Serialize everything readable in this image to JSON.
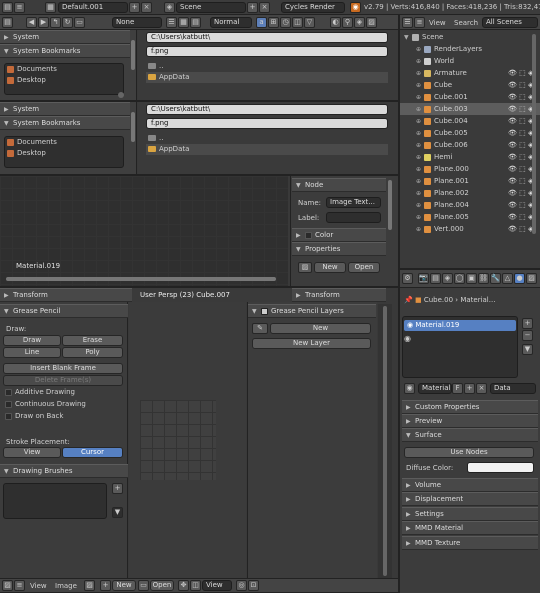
{
  "topbar": {
    "layout": "Default.001",
    "scene": "Scene",
    "engine": "Cycles Render",
    "stats": "v2.79 | Verts:416,840 | Faces:418,236 | Tris:832,472",
    "mode": "None",
    "blend_mode": "Normal"
  },
  "filebrowser_top": {
    "system_label": "System",
    "bookmarks_label": "System Bookmarks",
    "bookmarks": [
      "Documents",
      "Desktop"
    ],
    "path": "C:\\Users\\katbutt\\",
    "filename": "f.png",
    "items": [
      "..",
      "AppData"
    ]
  },
  "filebrowser_bottom": {
    "system_label": "System",
    "bookmarks_label": "System Bookmarks",
    "bookmarks": [
      "Documents",
      "Desktop"
    ],
    "path": "C:\\Users\\katbutt\\",
    "filename": "f.png",
    "items": [
      "..",
      "AppData"
    ]
  },
  "node_editor": {
    "label": "Material.019",
    "node_header": "Node",
    "name_label": "Name:",
    "name_value": "Image Text...",
    "label_label": "Label:",
    "color_label": "Color",
    "properties_label": "Properties",
    "new_button": "New",
    "open_button": "Open",
    "transform_label": "Transform"
  },
  "viewport": {
    "transform_label": "Transform",
    "user_persp": "User Persp",
    "object_info": "(23) Cube.007"
  },
  "grease_pencil": {
    "title": "Grease Pencil",
    "draw_label": "Draw:",
    "draw": "Draw",
    "erase": "Erase",
    "line": "Line",
    "poly": "Poly",
    "insert_blank": "Insert Blank Frame",
    "delete_frames": "Delete Frame(s)",
    "additive": "Additive Drawing",
    "continuous": "Continuous Drawing",
    "draw_on_back": "Draw on Back",
    "stroke_placement": "Stroke Placement:",
    "view": "View",
    "cursor": "Cursor",
    "brushes": "Drawing Brushes"
  },
  "gp_layers": {
    "title": "Grease Pencil Layers",
    "new": "New",
    "new_layer": "New Layer"
  },
  "bottom_bar": {
    "view": "View",
    "image": "Image",
    "new": "New",
    "open": "Open",
    "view2": "View"
  },
  "outliner": {
    "view": "View",
    "search": "Search",
    "all_scenes": "All Scenes",
    "items": [
      {
        "name": "Scene",
        "indent": 0,
        "color": "#b0b0b0",
        "sel": false
      },
      {
        "name": "RenderLayers",
        "indent": 1,
        "color": "#9aa8c0",
        "sel": false
      },
      {
        "name": "World",
        "indent": 1,
        "color": "#d0d0d0",
        "sel": false
      },
      {
        "name": "Armature",
        "indent": 1,
        "color": "#d8b860",
        "sel": false
      },
      {
        "name": "Cube",
        "indent": 1,
        "color": "#e09040",
        "sel": false
      },
      {
        "name": "Cube.001",
        "indent": 1,
        "color": "#e09040",
        "sel": false
      },
      {
        "name": "Cube.003",
        "indent": 1,
        "color": "#e09040",
        "sel": true
      },
      {
        "name": "Cube.004",
        "indent": 1,
        "color": "#e09040",
        "sel": false
      },
      {
        "name": "Cube.005",
        "indent": 1,
        "color": "#e09040",
        "sel": false
      },
      {
        "name": "Cube.006",
        "indent": 1,
        "color": "#e09040",
        "sel": false
      },
      {
        "name": "Hemi",
        "indent": 1,
        "color": "#e0d060",
        "sel": false
      },
      {
        "name": "Plane.000",
        "indent": 1,
        "color": "#e09040",
        "sel": false
      },
      {
        "name": "Plane.001",
        "indent": 1,
        "color": "#e09040",
        "sel": false
      },
      {
        "name": "Plane.002",
        "indent": 1,
        "color": "#e09040",
        "sel": false
      },
      {
        "name": "Plane.004",
        "indent": 1,
        "color": "#e09040",
        "sel": false
      },
      {
        "name": "Plane.005",
        "indent": 1,
        "color": "#e09040",
        "sel": false
      },
      {
        "name": "Vert.000",
        "indent": 1,
        "color": "#e09040",
        "sel": false
      }
    ]
  },
  "properties": {
    "object": "Cube.00",
    "material_crumb": "Material...",
    "slot": "Material.019",
    "material_field": "Material",
    "f_label": "F",
    "data_label": "Data",
    "panels": [
      "Custom Properties",
      "Preview",
      "Surface"
    ],
    "use_nodes": "Use Nodes",
    "diffuse_color": "Diffuse Color:",
    "collapsed": [
      "Volume",
      "Displacement",
      "Settings",
      "MMD Material",
      "MMD Texture"
    ]
  }
}
